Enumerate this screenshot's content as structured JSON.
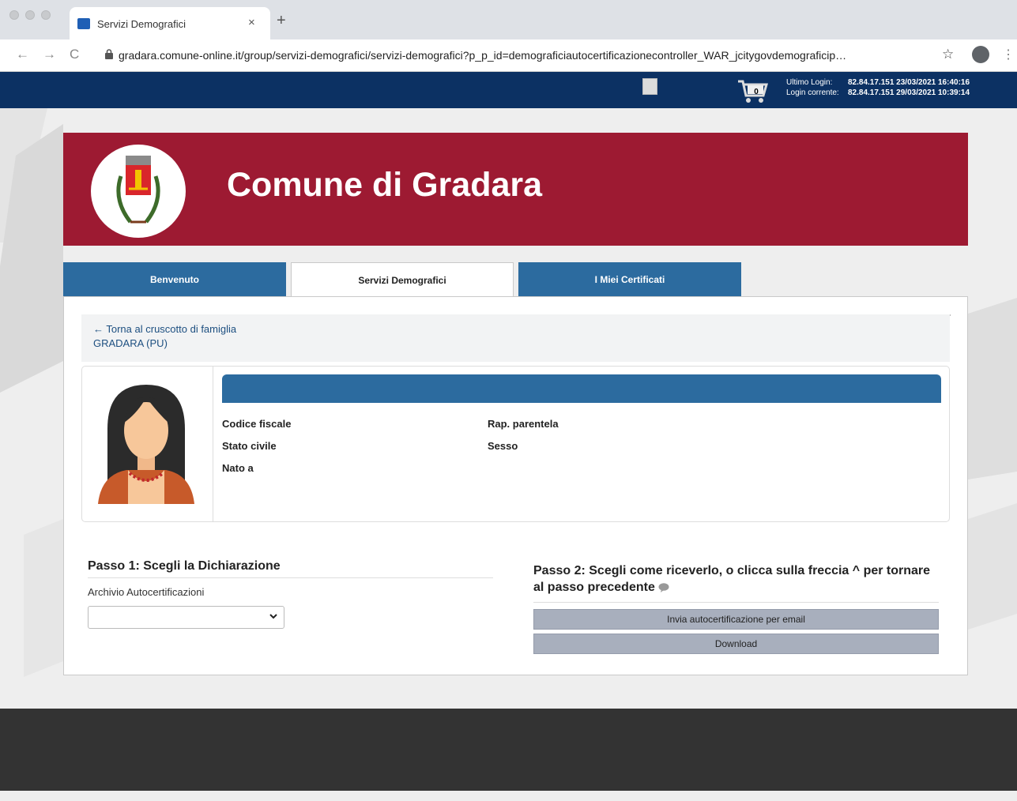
{
  "browser": {
    "tab_title": "Servizi Demografici",
    "tab_close": "×",
    "new_tab": "+",
    "url": "gradara.comune-online.it/group/servizi-demografici/servizi-demografici?p_p_id=demograficiautocertificazionecontroller_WAR_jcitygovdemograficip…",
    "back": "←",
    "forward": "→",
    "reload": "C",
    "star": "☆",
    "menu": "⋮"
  },
  "topbar": {
    "cart_count": "0",
    "ultimo_login_label": "Ultimo Login:",
    "ultimo_login_value": "82.84.17.151  23/03/2021 16:40:16",
    "login_corrente_label": "Login corrente:",
    "login_corrente_value": "82.84.17.151  29/03/2021 10:39:14"
  },
  "header": {
    "title": "Comune di Gradara",
    "brand_color": "#9d1a32"
  },
  "tabs": [
    {
      "label": "Benvenuto"
    },
    {
      "label": "Servizi Demografici"
    },
    {
      "label": "I Miei Certificati"
    }
  ],
  "breadcrumb": {
    "back_link": "← Torna al cruscotto di famiglia",
    "city": "GRADARA (PU)"
  },
  "person": {
    "fields": {
      "codice_fiscale": "Codice fiscale",
      "stato_civile": "Stato civile",
      "nato_a": "Nato a",
      "rap_parentela": "Rap. parentela",
      "sesso": "Sesso"
    }
  },
  "step1": {
    "title": "Passo 1: Scegli la Dichiarazione",
    "select_label": "Archivio Autocertificazioni",
    "select_value": ""
  },
  "step2": {
    "title": "Passo 2: Scegli come riceverlo, o clicca sulla freccia ^ per tornare al passo precedente",
    "email_button": "Invia autocertificazione per email",
    "download_button": "Download"
  }
}
